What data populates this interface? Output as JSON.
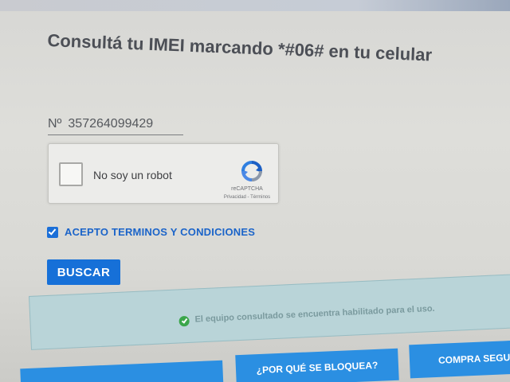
{
  "header": {
    "title": "Consultá tu IMEI marcando *#06# en tu celular"
  },
  "imei_input": {
    "prefix": "Nº",
    "value": "357264099429"
  },
  "captcha": {
    "label": "No soy un robot",
    "brand": "reCAPTCHA",
    "links": "Privacidad - Términos",
    "icon": "recaptcha-icon"
  },
  "terms": {
    "label": "ACEPTO TERMINOS Y CONDICIONES",
    "checked": true
  },
  "search_button": {
    "label": "BUSCAR"
  },
  "status": {
    "text": "El equipo consultado se encuentra habilitado para el uso.",
    "icon": "check-circle-icon",
    "color": "#3aa64a"
  },
  "bottom_buttons": {
    "left_label": "",
    "why_label": "¿POR QUÉ SE BLOQUEA?",
    "buy_label": "COMPRA SEGURA"
  },
  "colors": {
    "accent": "#1670d8",
    "status_background": "#b9d4d8"
  }
}
